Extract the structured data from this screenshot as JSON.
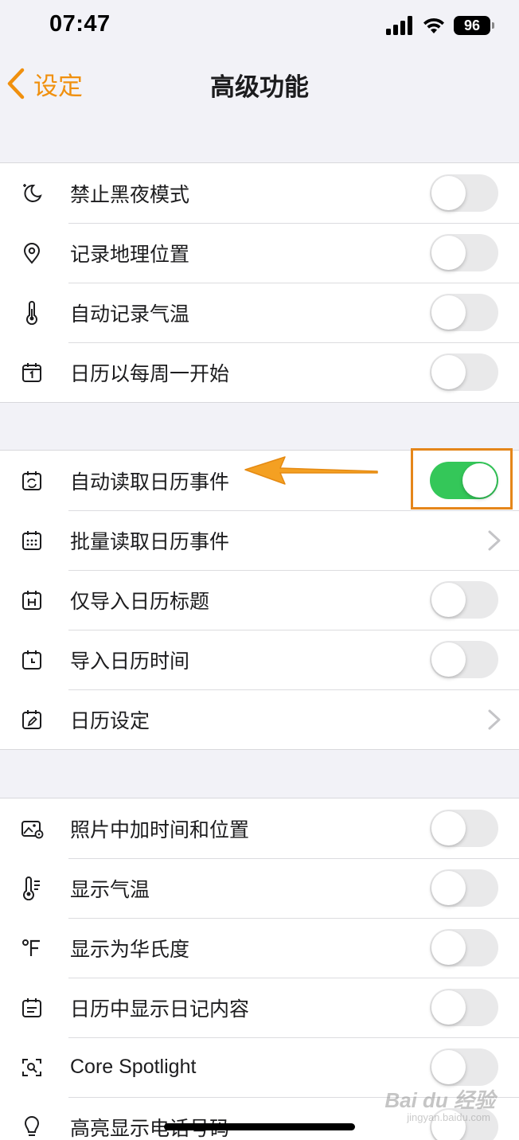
{
  "status_bar": {
    "time": "07:47",
    "battery": "96"
  },
  "nav": {
    "back_label": "设定",
    "title": "高级功能"
  },
  "colors": {
    "accent": "#f0900e",
    "toggle_on": "#34c759",
    "toggle_off": "#e9e9ea",
    "highlight": "#e5861a"
  },
  "groups": [
    {
      "rows": [
        {
          "label": "禁止黑夜模式",
          "icon": "moon-icon",
          "control": "toggle",
          "on": false
        },
        {
          "label": "记录地理位置",
          "icon": "location-pin-icon",
          "control": "toggle",
          "on": false
        },
        {
          "label": "自动记录气温",
          "icon": "thermometer-icon",
          "control": "toggle",
          "on": false
        },
        {
          "label": "日历以每周一开始",
          "icon": "calendar-one-icon",
          "control": "toggle",
          "on": false
        }
      ]
    },
    {
      "rows": [
        {
          "label": "自动读取日历事件",
          "icon": "calendar-sync-icon",
          "control": "toggle",
          "on": true
        },
        {
          "label": "批量读取日历事件",
          "icon": "calendar-grid-icon",
          "control": "chevron"
        },
        {
          "label": "仅导入日历标题",
          "icon": "calendar-h-icon",
          "control": "toggle",
          "on": false
        },
        {
          "label": "导入日历时间",
          "icon": "calendar-clock-icon",
          "control": "toggle",
          "on": false
        },
        {
          "label": "日历设定",
          "icon": "calendar-edit-icon",
          "control": "chevron"
        }
      ]
    },
    {
      "rows": [
        {
          "label": "照片中加时间和位置",
          "icon": "photo-location-icon",
          "control": "toggle",
          "on": false
        },
        {
          "label": "显示气温",
          "icon": "thermometer-scale-icon",
          "control": "toggle",
          "on": false
        },
        {
          "label": "显示为华氏度",
          "icon": "fahrenheit-icon",
          "control": "toggle",
          "on": false
        },
        {
          "label": "日历中显示日记内容",
          "icon": "calendar-list-icon",
          "control": "toggle",
          "on": false
        },
        {
          "label": "Core Spotlight",
          "icon": "spotlight-icon",
          "control": "toggle",
          "on": false
        },
        {
          "label": "高亮显示电话号码",
          "icon": "lightbulb-icon",
          "control": "toggle",
          "on": false
        }
      ]
    }
  ],
  "watermark": {
    "text": "Bai du 经验",
    "sub": "jingyan.baidu.com"
  }
}
